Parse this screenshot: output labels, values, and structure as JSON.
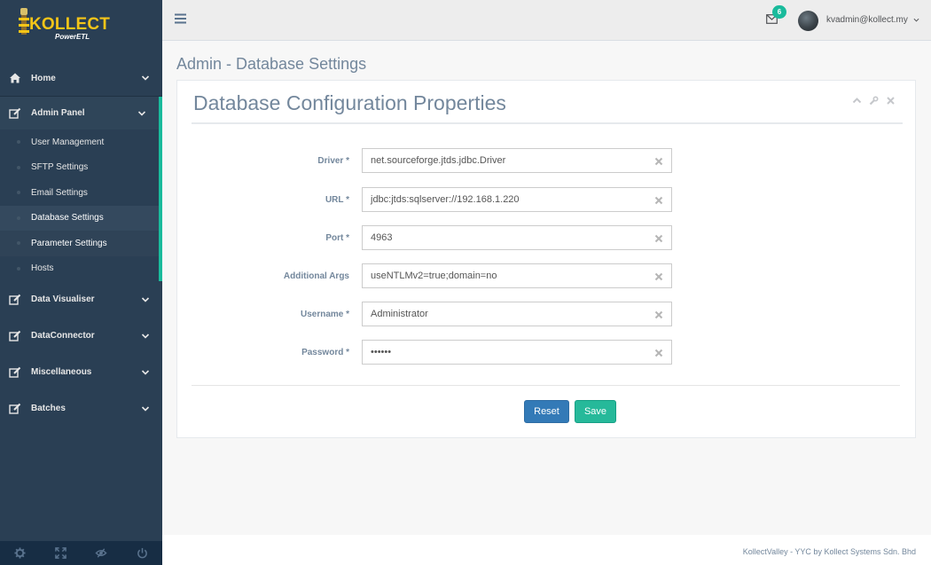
{
  "brand": {
    "name": "KOLLECT",
    "sub": "PowerETL"
  },
  "sidebar": {
    "home": "Home",
    "admin_panel": "Admin Panel",
    "admin_items": [
      "User Management",
      "SFTP Settings",
      "Email Settings",
      "Database Settings",
      "Parameter Settings",
      "Hosts"
    ],
    "data_visualiser": "Data Visualiser",
    "data_connector": "DataConnector",
    "miscellaneous": "Miscellaneous",
    "batches": "Batches"
  },
  "topnav": {
    "mail_count": "6",
    "user": "kvadmin@kollect.my"
  },
  "page": {
    "title": "Admin - Database Settings"
  },
  "panel": {
    "title": "Database Configuration Properties",
    "fields": [
      {
        "label": "Driver *",
        "value": "net.sourceforge.jtds.jdbc.Driver"
      },
      {
        "label": "URL *",
        "value": "jdbc:jtds:sqlserver://192.168.1.220"
      },
      {
        "label": "Port *",
        "value": "4963"
      },
      {
        "label": "Additional Args",
        "value": "useNTLMv2=true;domain=no"
      },
      {
        "label": "Username *",
        "value": "Administrator"
      },
      {
        "label": "Password *",
        "value": "••••••"
      }
    ],
    "reset": "Reset",
    "save": "Save"
  },
  "footer": {
    "text": "KollectValley - YYC by Kollect Systems Sdn. Bhd"
  },
  "colors": {
    "sidebar": "#2a3f54",
    "accent": "#1abb9c",
    "primary": "#337ab7",
    "success": "#26b99a"
  }
}
